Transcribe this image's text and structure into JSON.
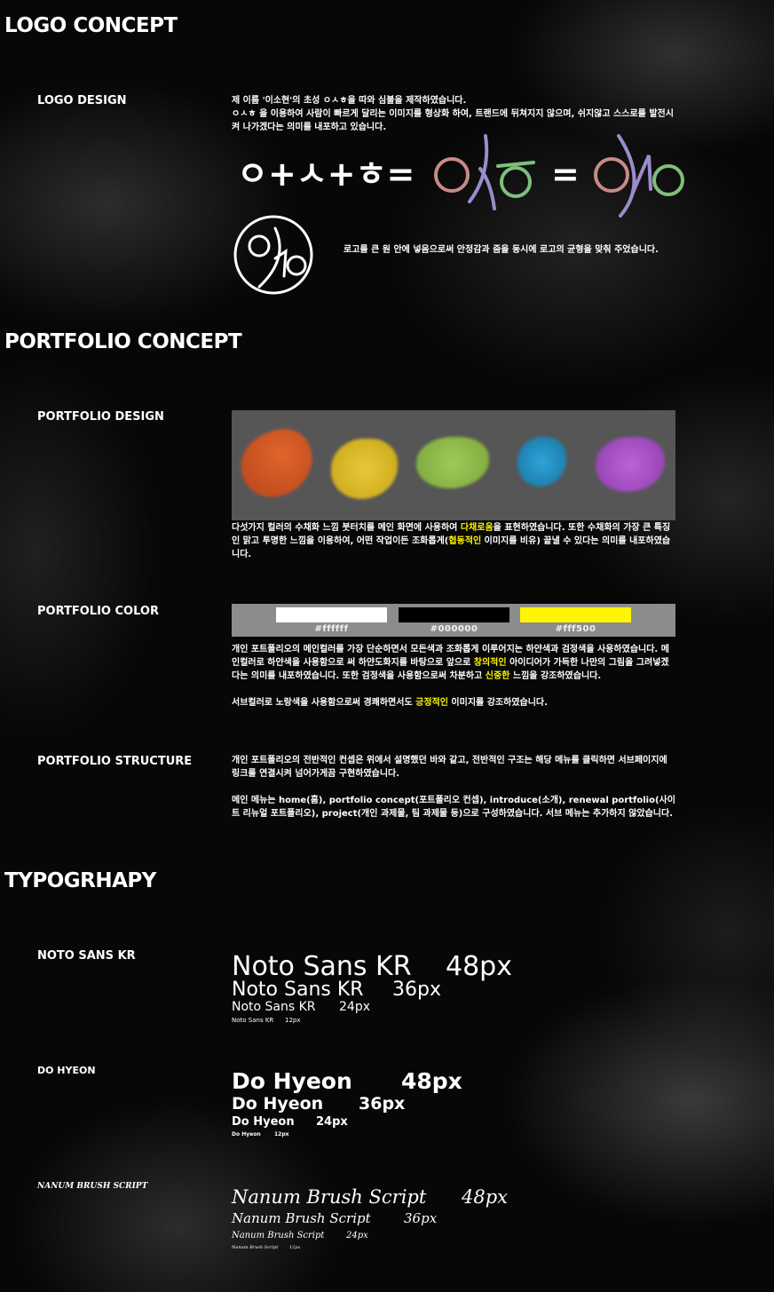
{
  "logo_concept": {
    "title": "LOGO CONCEPT",
    "design_label": "LOGO DESIGN",
    "desc_line1": "제 이름 '이소현'의 초성 ㅇㅅㅎ을 따와 심볼을 제작하였습니다.",
    "desc_line2": "ㅇㅅㅎ 을 이용하여 사람이 빠르게 달리는 이미지를 형상화 하여, 트랜드에 뒤쳐지지 않으며, 쉬지않고 스스로를 발전시켜 나가겠다는 의미를 내포하고 있습니다.",
    "formula": "ㅇ+ㅅ+ㅎ=",
    "equals": "=",
    "circle_desc": "로고를 큰 원 안에 넣음으로써 안정감과 줌을 동시에 로고의 균형을 맞춰 주었습니다.",
    "colors": {
      "o": "#c98a85",
      "s": "#9b8ccc",
      "h": "#7fbf7a"
    }
  },
  "portfolio_concept": {
    "title": "PORTFOLIO CONCEPT",
    "design_label": "PORTFOLIO DESIGN",
    "design_desc": {
      "a": "다섯가지 컬러의 수채화 느낌 붓터치를 메인 화면에 사용하여 ",
      "hl1": "다채로움",
      "b": "을 표현하였습니다. 또한 수채화의 가장 큰 특징인 맑고 투명한 느낌을 이용하여, 어떤 작업이든 조화롭게(",
      "hl2": "협동적인",
      "c": " 이미지를 비유) 끝낼 수 있다는 의미를 내포하였습니다."
    },
    "brush_colors": [
      "#d4531e",
      "#d8b41f",
      "#8cba48",
      "#1d8dc4",
      "#a34fc2"
    ],
    "color_label": "PORTFOLIO COLOR",
    "swatches": [
      {
        "hex": "#ffffff",
        "label": "#ffffff"
      },
      {
        "hex": "#000000",
        "label": "#000000"
      },
      {
        "hex": "#fff500",
        "label": "#fff500"
      }
    ],
    "color_desc": {
      "a": "개인 포트폴리오의 메인컬러를 가장 단순하면서 모든색과 조화롭게 이루어지는 하얀색과 검정색을 사용하였습니다. 메인컬러로 하얀색을 사용함으로 써 하얀도화지를 바탕으로 앞으로 ",
      "hl1": "창의적인",
      "b": " 아이디어가 가득한 나만의 그림을 그려넣겠다는 의미를 내포하였습니다. 또한 검정색을 사용함으로써 차분하고 ",
      "hl2": "신중한",
      "c": " 느낌을 강조하였습니다.",
      "sub_a": "서브컬러로 노랑색을 사용함으로써 경쾌하면서도 ",
      "sub_hl": "긍정적인",
      "sub_b": " 이미지를 강조하였습니다."
    },
    "structure_label": "PORTFOLIO STRUCTURE",
    "structure_p1": "개인 포트폴리오의 전반적인 컨셉은 위에서 설명했던 바와 같고, 전반적인 구조는 해당 메뉴를 클릭하면 서브페이지에 링크를 연결시켜 넘어가게끔 구현하였습니다.",
    "structure_p2": "메인 메뉴는 home(홈), portfolio concept(포트폴리오 컨셉), introduce(소개), renewal portfolio(사이트 리뉴얼 포트폴리오), project(개인 과제물, 팀 과제물 등)으로 구성하였습니다. 서브 메뉴는 추가하지 않았습니다."
  },
  "typography": {
    "title": "TYPOGRHAPY",
    "fonts": [
      {
        "label": "NOTO SANS KR",
        "name": "Noto Sans KR",
        "sizes": [
          "48px",
          "36px",
          "24px",
          "12px"
        ]
      },
      {
        "label": "DO HYEON",
        "name": "Do Hyeon",
        "sizes": [
          "48px",
          "36px",
          "24px",
          "12px"
        ]
      },
      {
        "label": "NANUM BRUSH SCRIPT",
        "name": "Nanum Brush Script",
        "sizes": [
          "48px",
          "36px",
          "24px",
          "12px"
        ]
      }
    ]
  }
}
